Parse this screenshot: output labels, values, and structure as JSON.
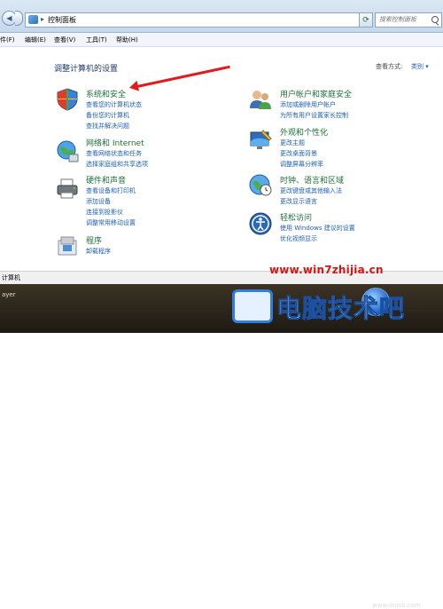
{
  "address": {
    "sep": "▸",
    "path": "控制面板",
    "drop": "▾",
    "refresh": "⟳",
    "search_placeholder": "搜索控制面板"
  },
  "menu": [
    "件(F)",
    "编辑(E)",
    "查看(V)",
    "工具(T)",
    "帮助(H)"
  ],
  "page": {
    "heading": "调整计算机的设置",
    "viewby_label": "查看方式:",
    "viewby_value": "类别 ▾"
  },
  "categories": {
    "system": {
      "title": "系统和安全",
      "links": [
        "查看您的计算机状态",
        "备份您的计算机",
        "查找并解决问题"
      ]
    },
    "network": {
      "title": "网络和 Internet",
      "links": [
        "查看网络状态和任务",
        "选择家庭组和共享选项"
      ]
    },
    "hardware": {
      "title": "硬件和声音",
      "links": [
        "查看设备和打印机",
        "添加设备",
        "连接到投影仪",
        "调整常用移动设置"
      ]
    },
    "programs": {
      "title": "程序",
      "links": [
        "卸载程序"
      ]
    },
    "users": {
      "title": "用户帐户和家庭安全",
      "links": [
        "添加或删除用户帐户",
        "为所有用户设置家长控制"
      ]
    },
    "appearance": {
      "title": "外观和个性化",
      "links": [
        "更改主题",
        "更改桌面背景",
        "调整屏幕分辨率"
      ]
    },
    "clock": {
      "title": "时钟、语言和区域",
      "links": [
        "更改键盘或其他输入法",
        "更改显示语言"
      ]
    },
    "ease": {
      "title": "轻松访问",
      "links": [
        "使用 Windows 建议的设置",
        "优化视频显示"
      ]
    }
  },
  "status": "计算机",
  "taskbar": "ayer",
  "watermark": {
    "url": "www.win7zhijia.cn",
    "brand": "电脑技术吧",
    "sub": "www.dnjsb.com"
  },
  "colors": {
    "link": "#1e5fb3",
    "category_title": "#1f6f3a",
    "heading": "#1e3c6e",
    "arrow": "#e11c1c",
    "watermark_url": "#d91414"
  }
}
